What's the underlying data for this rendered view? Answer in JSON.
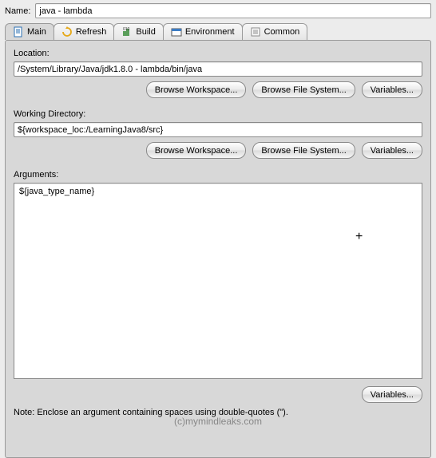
{
  "name_field": {
    "label": "Name:",
    "value": "java - lambda"
  },
  "tabs": [
    {
      "label": "Main"
    },
    {
      "label": "Refresh"
    },
    {
      "label": "Build"
    },
    {
      "label": "Environment"
    },
    {
      "label": "Common"
    }
  ],
  "location": {
    "label": "Location:",
    "value": "/System/Library/Java/jdk1.8.0 - lambda/bin/java",
    "buttons": {
      "workspace": "Browse Workspace...",
      "filesystem": "Browse File System...",
      "variables": "Variables..."
    }
  },
  "working_directory": {
    "label": "Working Directory:",
    "value": "${workspace_loc:/LearningJava8/src}",
    "buttons": {
      "workspace": "Browse Workspace...",
      "filesystem": "Browse File System...",
      "variables": "Variables..."
    }
  },
  "arguments": {
    "label": "Arguments:",
    "value": "${java_type_name}",
    "buttons": {
      "variables": "Variables..."
    },
    "note": "Note: Enclose an argument containing spaces using double-quotes (\")."
  },
  "watermark": "(c)mymindleaks.com"
}
